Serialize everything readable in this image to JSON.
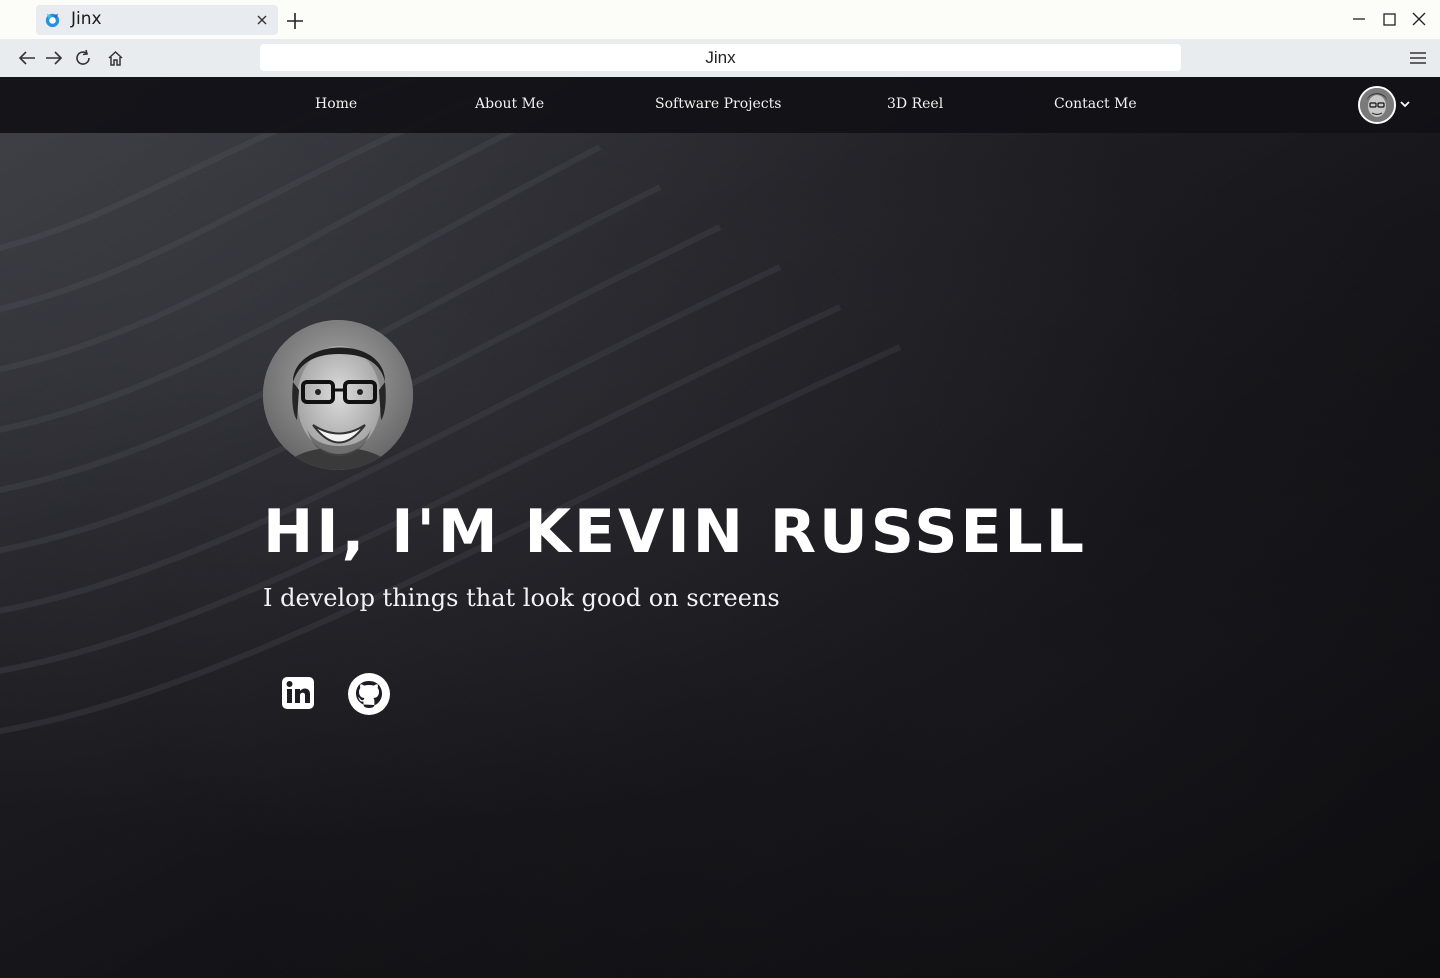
{
  "browser": {
    "tab": {
      "title": "Jinx"
    },
    "address_bar": {
      "value": "Jinx"
    }
  },
  "site": {
    "nav": {
      "links": [
        {
          "label": "Home"
        },
        {
          "label": "About Me"
        },
        {
          "label": "Software Projects"
        },
        {
          "label": "3D Reel"
        },
        {
          "label": "Contact Me"
        }
      ]
    },
    "hero": {
      "title": "HI, I'M KEVIN RUSSELL",
      "subtitle": "I develop things that look good on screens"
    },
    "social": [
      {
        "icon": "linkedin-icon"
      },
      {
        "icon": "github-icon"
      }
    ]
  },
  "colors": {
    "nav_background": "#101016",
    "text": "#ffffff",
    "browser_toolbar": "#e9ecef",
    "tab_active": "#e8ebef"
  }
}
